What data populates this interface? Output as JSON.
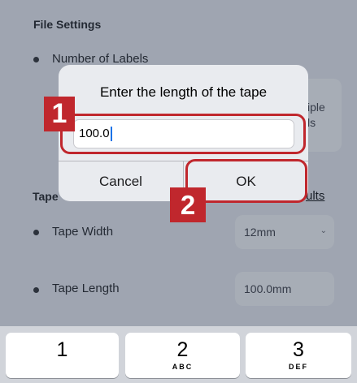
{
  "background": {
    "section_title": "File Settings",
    "number_of_labels": "Number of Labels",
    "multi_partial_1": "iple",
    "multi_partial_2": "ls",
    "tape_section_partial": "Tape",
    "reset_partial": "ults",
    "tape_width_label": "Tape Width",
    "tape_width_value": "12mm",
    "tape_length_label": "Tape Length",
    "tape_length_value": "100.0mm"
  },
  "dialog": {
    "title": "Enter the length of the tape",
    "input_value": "100.0",
    "cancel_label": "Cancel",
    "ok_label": "OK"
  },
  "callouts": {
    "step1": "1",
    "step2": "2"
  },
  "keyboard": {
    "keys": [
      {
        "num": "1",
        "letters": ""
      },
      {
        "num": "2",
        "letters": "ABC"
      },
      {
        "num": "3",
        "letters": "DEF"
      }
    ]
  },
  "colors": {
    "callout": "#c0272d",
    "overlay": "rgba(45,60,80,0.42)",
    "caret": "#1a73e8"
  }
}
